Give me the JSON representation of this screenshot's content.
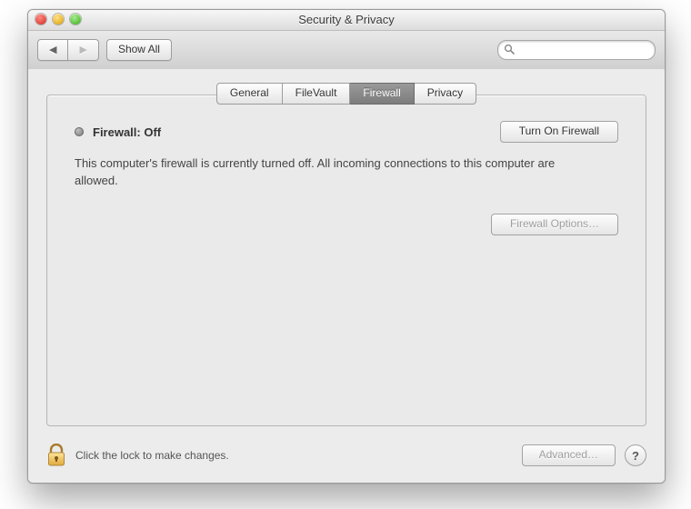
{
  "window": {
    "title": "Security & Privacy"
  },
  "toolbar": {
    "show_all": "Show All",
    "search_placeholder": ""
  },
  "tabs": [
    {
      "label": "General",
      "selected": false
    },
    {
      "label": "FileVault",
      "selected": false
    },
    {
      "label": "Firewall",
      "selected": true
    },
    {
      "label": "Privacy",
      "selected": false
    }
  ],
  "main": {
    "status_label": "Firewall: Off",
    "status_state": "off",
    "turn_on_label": "Turn On Firewall",
    "description": "This computer's firewall is currently turned off. All incoming connections to this computer are allowed.",
    "options_label": "Firewall Options…",
    "options_enabled": false
  },
  "footer": {
    "lock_message": "Click the lock to make changes.",
    "locked": true,
    "advanced_label": "Advanced…",
    "advanced_enabled": false
  },
  "colors": {
    "window_bg": "#ececec",
    "tab_selected_bg_top": "#9a9a9a",
    "tab_selected_bg_bottom": "#7c7c7c"
  }
}
